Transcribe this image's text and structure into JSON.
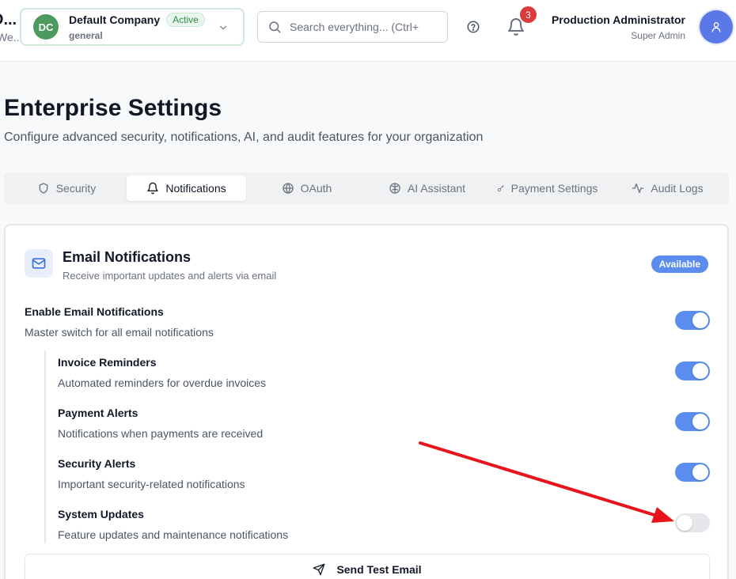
{
  "header": {
    "brand_title": "D...",
    "brand_sub": "We...",
    "company": {
      "initials": "DC",
      "name": "Default Company",
      "status": "Active",
      "subtitle": "general"
    },
    "search": {
      "placeholder": "Search everything... (Ctrl+"
    },
    "notifications_count": "3",
    "user": {
      "name": "Production Administrator",
      "role": "Super Admin"
    }
  },
  "page": {
    "title": "Enterprise Settings",
    "subtitle": "Configure advanced security, notifications, AI, and audit features for your organization"
  },
  "tabs": [
    {
      "label": "Security",
      "icon": "shield-icon",
      "active": false
    },
    {
      "label": "Notifications",
      "icon": "bell-icon",
      "active": true
    },
    {
      "label": "OAuth",
      "icon": "globe-icon",
      "active": false
    },
    {
      "label": "AI Assistant",
      "icon": "brain-icon",
      "active": false
    },
    {
      "label": "Payment Settings",
      "icon": "key-icon",
      "active": false
    },
    {
      "label": "Audit Logs",
      "icon": "activity-icon",
      "active": false
    }
  ],
  "email_card": {
    "title": "Email Notifications",
    "subtitle": "Receive important updates and alerts via email",
    "badge": "Available",
    "settings": [
      {
        "title": "Enable Email Notifications",
        "description": "Master switch for all email notifications",
        "enabled": true
      },
      {
        "title": "Invoice Reminders",
        "description": "Automated reminders for overdue invoices",
        "enabled": true
      },
      {
        "title": "Payment Alerts",
        "description": "Notifications when payments are received",
        "enabled": true
      },
      {
        "title": "Security Alerts",
        "description": "Important security-related notifications",
        "enabled": true
      },
      {
        "title": "System Updates",
        "description": "Feature updates and maintenance notifications",
        "enabled": false
      }
    ],
    "send_test_label": "Send Test Email"
  },
  "colors": {
    "accent": "#5b8def",
    "company_avatar": "#4c9a5e",
    "badge_red": "#dc3b3b",
    "annotation_arrow": "#e8141b"
  }
}
